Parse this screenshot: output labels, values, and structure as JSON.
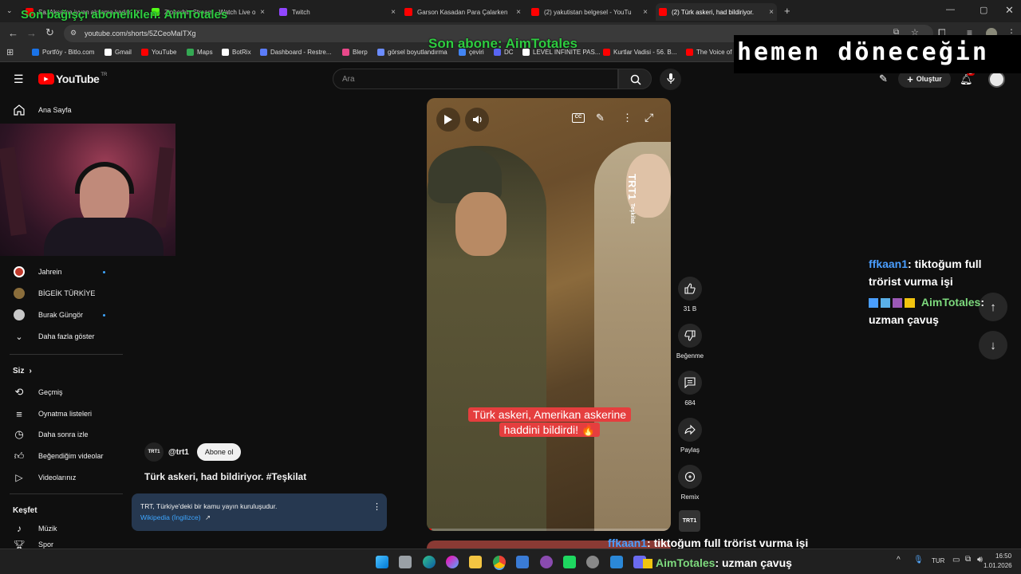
{
  "browser": {
    "tabs": [
      {
        "label": "Sa. Akşama iyyan akşama kadar",
        "color": "#ff0000"
      },
      {
        "label": "Zipperbin Stream - Watch Live o",
        "color": "#53fc18"
      },
      {
        "label": "Twitch",
        "color": "#9146ff"
      },
      {
        "label": "Garson Kasadan Para Çalarken",
        "color": "#ff0000"
      },
      {
        "label": "(2) yakutistan belgesel - YouTu",
        "color": "#ff0000"
      },
      {
        "label": "(2) Türk askeri, had bildiriyor.",
        "color": "#ff0000"
      }
    ],
    "url": "youtube.com/shorts/5ZCeoMaITXg",
    "bookmarks": [
      {
        "label": "Portföy - Bitlo.com",
        "color": "#1a73e8"
      },
      {
        "label": "Gmail",
        "color": "#ffffff"
      },
      {
        "label": "YouTube",
        "color": "#ff0000"
      },
      {
        "label": "Maps",
        "color": "#34a853"
      },
      {
        "label": "BotRix",
        "color": "#ffffff"
      },
      {
        "label": "Dashboard - Restre...",
        "color": "#5b7cfa"
      },
      {
        "label": "Blerp",
        "color": "#e8488a"
      },
      {
        "label": "görsel boyutlandırma",
        "color": "#6b8cff"
      },
      {
        "label": "çeviri",
        "color": "#4285f4"
      },
      {
        "label": "DC",
        "color": "#5865f2"
      },
      {
        "label": "LEVEL INFINITE PAS...",
        "color": "#ffffff"
      },
      {
        "label": "Kurtlar Vadisi - 56. B...",
        "color": "#ff0000"
      },
      {
        "label": "The Voice of Battle",
        "color": "#ff0000"
      }
    ]
  },
  "overlay": {
    "top_donor": "Son bağışçı aboneliklen: AimTotales",
    "last_sub": "Son abone: AimTotales",
    "brb": "hemen döneceğin"
  },
  "youtube": {
    "logo_text": "YouTube",
    "logo_sup": "TR",
    "search_placeholder": "Ara",
    "create_label": "Oluştur",
    "notif_count": "2"
  },
  "sidebar": {
    "home": "Ana Sayfa",
    "subs": [
      {
        "label": "Jahrein",
        "avatar": "#c0392b"
      },
      {
        "label": "BİGEİK TÜRKİYE",
        "avatar": "#8a6d3b"
      },
      {
        "label": "Burak Güngör",
        "avatar": "#c8c8c8"
      }
    ],
    "show_more": "Daha fazla göster",
    "you_label": "Siz",
    "you_items": [
      "Geçmiş",
      "Oynatma listeleri",
      "Daha sonra izle",
      "Beğendiğim videolar",
      "Videolarınız"
    ],
    "explore_label": "Keşfet",
    "explore_items": [
      "Müzik",
      "Spor"
    ]
  },
  "short": {
    "watermark_top": "TRT1",
    "watermark_bottom": "Teşkilat",
    "caption": "Türk askeri, Amerikan askerine haddini bildirdi! 🔥",
    "channel_handle": "@trt1",
    "channel_badge": "TRT1",
    "subscribe_label": "Abone ol",
    "title": "Türk askeri, had bildiriyor. #Teşkilat",
    "info_text": "TRT, Türkiye'deki bir kamu yayın kuruluşudur.",
    "info_link": "Wikipedia (İngilizce)",
    "info_link_arrow": "↗",
    "like_count": "31 B",
    "dislike_label": "Beğenme",
    "comment_count": "684",
    "share_label": "Paylaş",
    "remix_label": "Remix",
    "progress": 0.02
  },
  "chat": {
    "messages": [
      {
        "user": "ffkaan1",
        "text": ": tiktoğum full trörist vurma işi",
        "user_color": "#4a9eff"
      },
      {
        "user": "AimTotales",
        "text": ": uzman çavuş",
        "user_color": "#7dd97d"
      }
    ],
    "bottom_messages": [
      {
        "user": "ffkaan1",
        "text": ": tiktoğum full trörist vurma işi",
        "user_color": "#4a9eff"
      },
      {
        "user": "AimTotales",
        "text": ": uzman çavuş",
        "user_color": "#7dd97d"
      }
    ]
  },
  "taskbar": {
    "lang": "TUR",
    "time": "16:50",
    "date": "1.01.2026"
  }
}
